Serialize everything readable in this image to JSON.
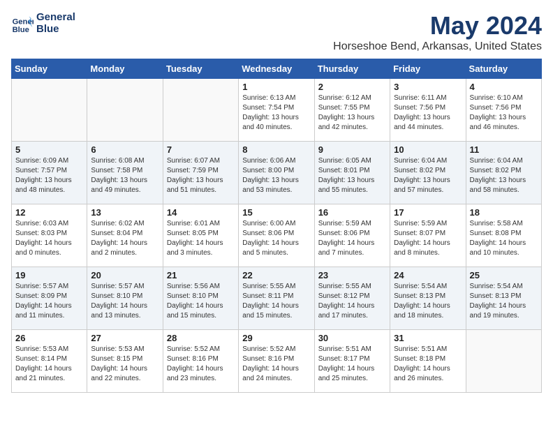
{
  "header": {
    "logo_line1": "General",
    "logo_line2": "Blue",
    "month_year": "May 2024",
    "location": "Horseshoe Bend, Arkansas, United States"
  },
  "weekdays": [
    "Sunday",
    "Monday",
    "Tuesday",
    "Wednesday",
    "Thursday",
    "Friday",
    "Saturday"
  ],
  "weeks": [
    [
      {
        "day": "",
        "sunrise": "",
        "sunset": "",
        "daylight": ""
      },
      {
        "day": "",
        "sunrise": "",
        "sunset": "",
        "daylight": ""
      },
      {
        "day": "",
        "sunrise": "",
        "sunset": "",
        "daylight": ""
      },
      {
        "day": "1",
        "sunrise": "Sunrise: 6:13 AM",
        "sunset": "Sunset: 7:54 PM",
        "daylight": "Daylight: 13 hours and 40 minutes."
      },
      {
        "day": "2",
        "sunrise": "Sunrise: 6:12 AM",
        "sunset": "Sunset: 7:55 PM",
        "daylight": "Daylight: 13 hours and 42 minutes."
      },
      {
        "day": "3",
        "sunrise": "Sunrise: 6:11 AM",
        "sunset": "Sunset: 7:56 PM",
        "daylight": "Daylight: 13 hours and 44 minutes."
      },
      {
        "day": "4",
        "sunrise": "Sunrise: 6:10 AM",
        "sunset": "Sunset: 7:56 PM",
        "daylight": "Daylight: 13 hours and 46 minutes."
      }
    ],
    [
      {
        "day": "5",
        "sunrise": "Sunrise: 6:09 AM",
        "sunset": "Sunset: 7:57 PM",
        "daylight": "Daylight: 13 hours and 48 minutes."
      },
      {
        "day": "6",
        "sunrise": "Sunrise: 6:08 AM",
        "sunset": "Sunset: 7:58 PM",
        "daylight": "Daylight: 13 hours and 49 minutes."
      },
      {
        "day": "7",
        "sunrise": "Sunrise: 6:07 AM",
        "sunset": "Sunset: 7:59 PM",
        "daylight": "Daylight: 13 hours and 51 minutes."
      },
      {
        "day": "8",
        "sunrise": "Sunrise: 6:06 AM",
        "sunset": "Sunset: 8:00 PM",
        "daylight": "Daylight: 13 hours and 53 minutes."
      },
      {
        "day": "9",
        "sunrise": "Sunrise: 6:05 AM",
        "sunset": "Sunset: 8:01 PM",
        "daylight": "Daylight: 13 hours and 55 minutes."
      },
      {
        "day": "10",
        "sunrise": "Sunrise: 6:04 AM",
        "sunset": "Sunset: 8:02 PM",
        "daylight": "Daylight: 13 hours and 57 minutes."
      },
      {
        "day": "11",
        "sunrise": "Sunrise: 6:04 AM",
        "sunset": "Sunset: 8:02 PM",
        "daylight": "Daylight: 13 hours and 58 minutes."
      }
    ],
    [
      {
        "day": "12",
        "sunrise": "Sunrise: 6:03 AM",
        "sunset": "Sunset: 8:03 PM",
        "daylight": "Daylight: 14 hours and 0 minutes."
      },
      {
        "day": "13",
        "sunrise": "Sunrise: 6:02 AM",
        "sunset": "Sunset: 8:04 PM",
        "daylight": "Daylight: 14 hours and 2 minutes."
      },
      {
        "day": "14",
        "sunrise": "Sunrise: 6:01 AM",
        "sunset": "Sunset: 8:05 PM",
        "daylight": "Daylight: 14 hours and 3 minutes."
      },
      {
        "day": "15",
        "sunrise": "Sunrise: 6:00 AM",
        "sunset": "Sunset: 8:06 PM",
        "daylight": "Daylight: 14 hours and 5 minutes."
      },
      {
        "day": "16",
        "sunrise": "Sunrise: 5:59 AM",
        "sunset": "Sunset: 8:06 PM",
        "daylight": "Daylight: 14 hours and 7 minutes."
      },
      {
        "day": "17",
        "sunrise": "Sunrise: 5:59 AM",
        "sunset": "Sunset: 8:07 PM",
        "daylight": "Daylight: 14 hours and 8 minutes."
      },
      {
        "day": "18",
        "sunrise": "Sunrise: 5:58 AM",
        "sunset": "Sunset: 8:08 PM",
        "daylight": "Daylight: 14 hours and 10 minutes."
      }
    ],
    [
      {
        "day": "19",
        "sunrise": "Sunrise: 5:57 AM",
        "sunset": "Sunset: 8:09 PM",
        "daylight": "Daylight: 14 hours and 11 minutes."
      },
      {
        "day": "20",
        "sunrise": "Sunrise: 5:57 AM",
        "sunset": "Sunset: 8:10 PM",
        "daylight": "Daylight: 14 hours and 13 minutes."
      },
      {
        "day": "21",
        "sunrise": "Sunrise: 5:56 AM",
        "sunset": "Sunset: 8:10 PM",
        "daylight": "Daylight: 14 hours and 15 minutes."
      },
      {
        "day": "22",
        "sunrise": "Sunrise: 5:55 AM",
        "sunset": "Sunset: 8:11 PM",
        "daylight": "Daylight: 14 hours and 15 minutes."
      },
      {
        "day": "23",
        "sunrise": "Sunrise: 5:55 AM",
        "sunset": "Sunset: 8:12 PM",
        "daylight": "Daylight: 14 hours and 17 minutes."
      },
      {
        "day": "24",
        "sunrise": "Sunrise: 5:54 AM",
        "sunset": "Sunset: 8:13 PM",
        "daylight": "Daylight: 14 hours and 18 minutes."
      },
      {
        "day": "25",
        "sunrise": "Sunrise: 5:54 AM",
        "sunset": "Sunset: 8:13 PM",
        "daylight": "Daylight: 14 hours and 19 minutes."
      }
    ],
    [
      {
        "day": "26",
        "sunrise": "Sunrise: 5:53 AM",
        "sunset": "Sunset: 8:14 PM",
        "daylight": "Daylight: 14 hours and 21 minutes."
      },
      {
        "day": "27",
        "sunrise": "Sunrise: 5:53 AM",
        "sunset": "Sunset: 8:15 PM",
        "daylight": "Daylight: 14 hours and 22 minutes."
      },
      {
        "day": "28",
        "sunrise": "Sunrise: 5:52 AM",
        "sunset": "Sunset: 8:16 PM",
        "daylight": "Daylight: 14 hours and 23 minutes."
      },
      {
        "day": "29",
        "sunrise": "Sunrise: 5:52 AM",
        "sunset": "Sunset: 8:16 PM",
        "daylight": "Daylight: 14 hours and 24 minutes."
      },
      {
        "day": "30",
        "sunrise": "Sunrise: 5:51 AM",
        "sunset": "Sunset: 8:17 PM",
        "daylight": "Daylight: 14 hours and 25 minutes."
      },
      {
        "day": "31",
        "sunrise": "Sunrise: 5:51 AM",
        "sunset": "Sunset: 8:18 PM",
        "daylight": "Daylight: 14 hours and 26 minutes."
      },
      {
        "day": "",
        "sunrise": "",
        "sunset": "",
        "daylight": ""
      }
    ]
  ]
}
